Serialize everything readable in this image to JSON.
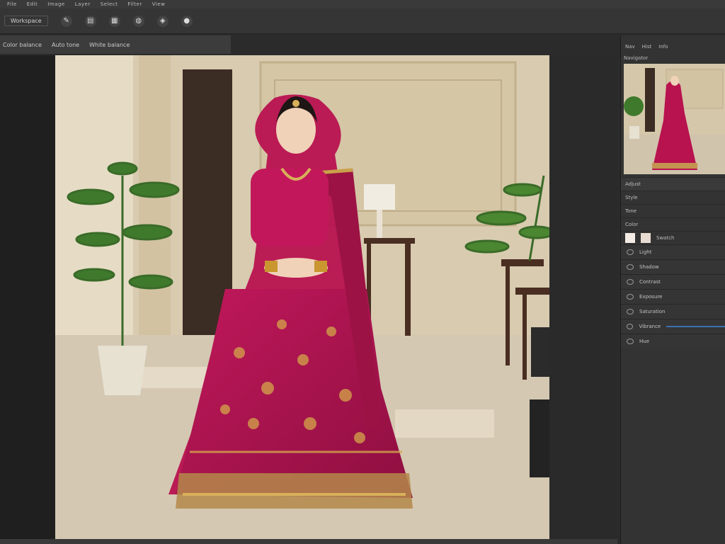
{
  "menu": [
    "File",
    "Edit",
    "Image",
    "Layer",
    "Select",
    "Filter",
    "View"
  ],
  "toolbar": {
    "mode_label": "Workspace",
    "tools": [
      {
        "icon": "brush-icon",
        "glyph": "✎"
      },
      {
        "icon": "document-icon",
        "glyph": "▤"
      },
      {
        "icon": "layers-icon",
        "glyph": "▦"
      },
      {
        "icon": "globe-icon",
        "glyph": "◍"
      },
      {
        "icon": "shield-icon",
        "glyph": "◈"
      },
      {
        "icon": "drop-icon",
        "glyph": "●"
      }
    ]
  },
  "options_bar": [
    "Color balance",
    "Auto tone",
    "White balance"
  ],
  "panel": {
    "tabs": [
      "Nav",
      "Hist",
      "Info"
    ],
    "navigator_title": "Navigator",
    "sections": [
      {
        "label": "Adjust",
        "value": ""
      },
      {
        "label": "Style",
        "value": ""
      },
      {
        "label": "Tone",
        "value": ""
      },
      {
        "label": "Color",
        "value": ""
      }
    ],
    "swatches_label": "Swatch",
    "layers": [
      "Light",
      "Shadow",
      "Contrast",
      "Exposure",
      "Saturation",
      "Vibrance",
      "Hue"
    ]
  },
  "colors": {
    "accent": "#3b6fb0",
    "panel_bg": "#333333",
    "canvas_bg": "#1f1f1f"
  }
}
